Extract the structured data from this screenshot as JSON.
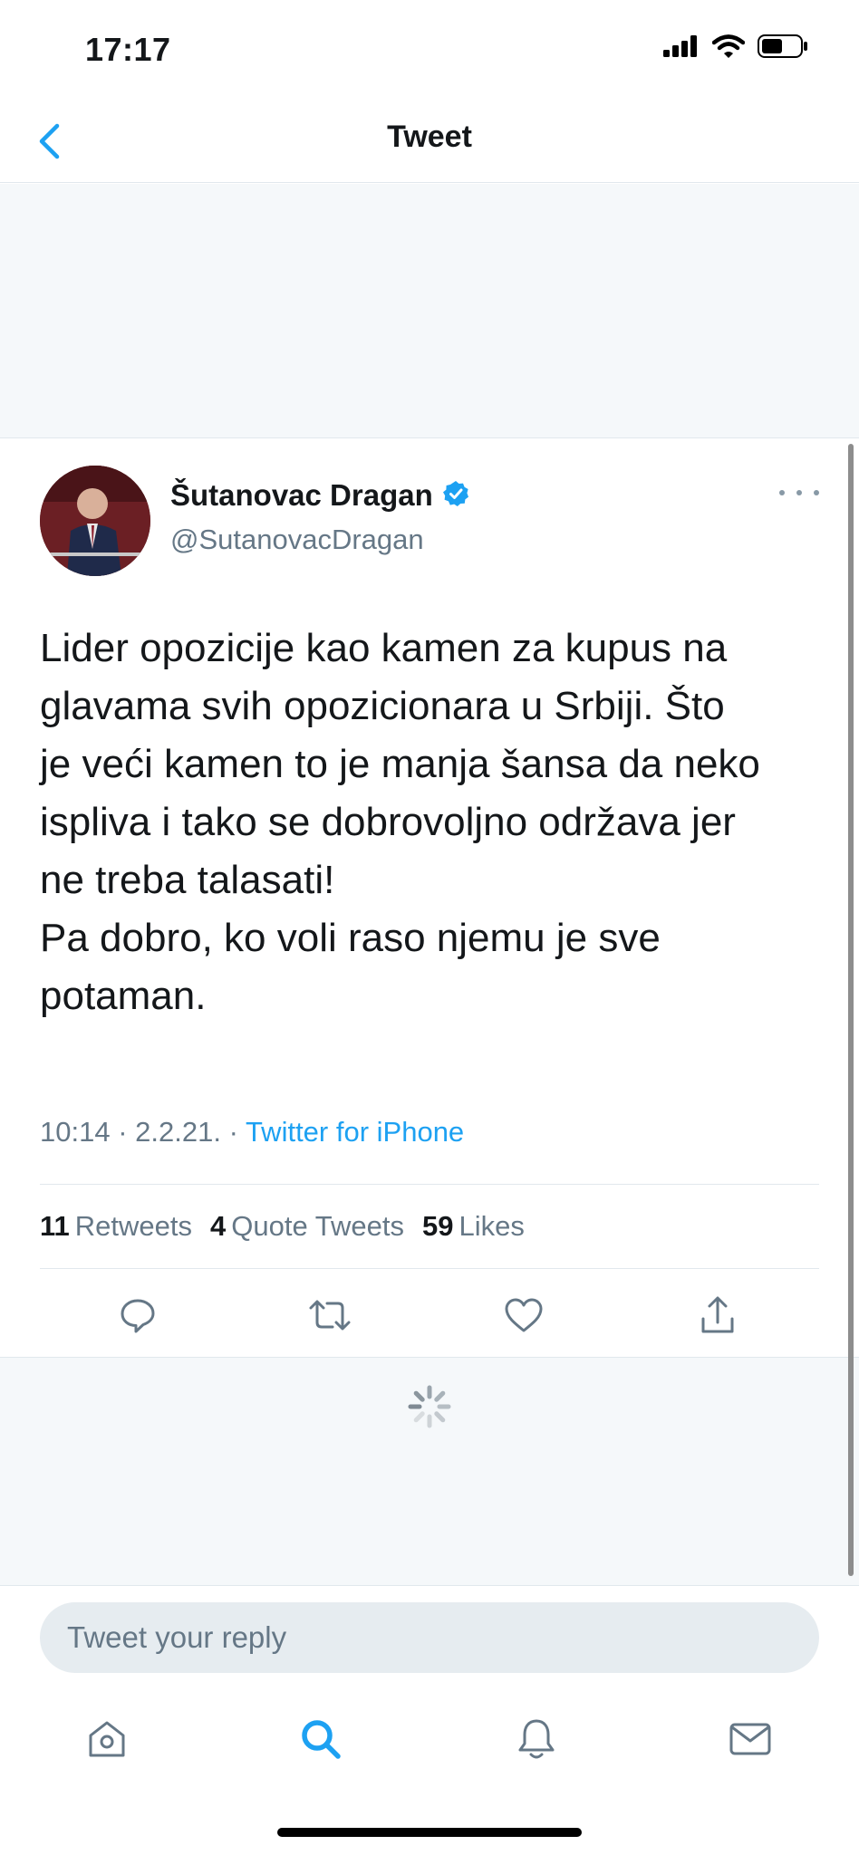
{
  "status_bar": {
    "time": "17:17"
  },
  "header": {
    "title": "Tweet"
  },
  "tweet": {
    "display_name": "Šutanovac Dragan",
    "handle": "@SutanovacDragan",
    "text_lines": [
      "Lider opozicije kao kamen za kupus na",
      "glavama svih opozicionara u Srbiji. Što",
      "je veći kamen to je manja šansa da neko",
      "ispliva i tako se dobrovoljno održava jer",
      "ne treba talasati!",
      "Pa dobro, ko voli raso njemu je sve",
      "potaman."
    ],
    "time": "10:14",
    "date": "2.2.21.",
    "source": "Twitter for iPhone",
    "stats": {
      "retweets_count": "11",
      "retweets_label": "Retweets",
      "quotes_count": "4",
      "quotes_label": "Quote Tweets",
      "likes_count": "59",
      "likes_label": "Likes"
    }
  },
  "reply": {
    "placeholder": "Tweet your reply"
  },
  "colors": {
    "accent": "#1da1f2",
    "secondary_text": "#657786",
    "divider": "#e1e8ed",
    "background_grey": "#f5f8fa"
  },
  "icons": {
    "status": [
      "cellular-signal-icon",
      "wifi-icon",
      "battery-icon"
    ],
    "actions": [
      "reply-icon",
      "retweet-icon",
      "like-icon",
      "share-icon"
    ],
    "tabs": [
      "home-icon",
      "search-icon",
      "notifications-icon",
      "messages-icon"
    ]
  }
}
